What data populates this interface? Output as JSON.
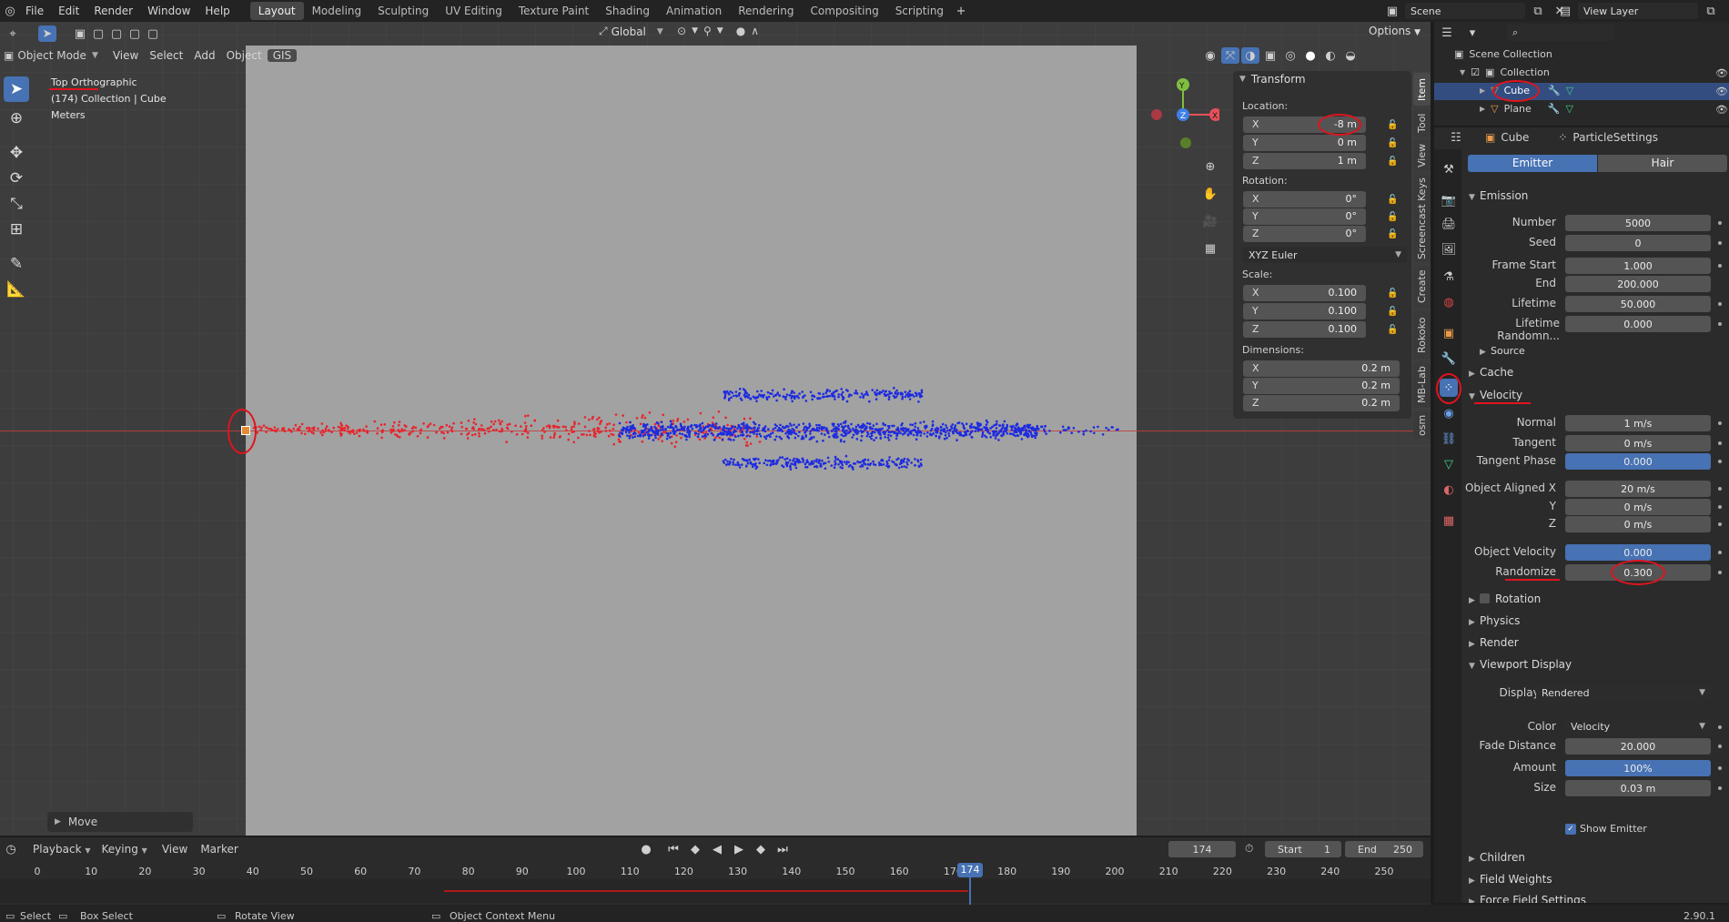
{
  "menu": [
    "File",
    "Edit",
    "Render",
    "Window",
    "Help"
  ],
  "workspaces": [
    "Layout",
    "Modeling",
    "Sculpting",
    "UV Editing",
    "Texture Paint",
    "Shading",
    "Animation",
    "Rendering",
    "Compositing",
    "Scripting"
  ],
  "active_workspace": "Layout",
  "scene_name": "Scene",
  "view_layer": "View Layer",
  "header": {
    "transform_orientation": "Global",
    "options_label": "Options",
    "mode": "Object Mode",
    "menus": [
      "View",
      "Select",
      "Add",
      "Object",
      "GIS"
    ]
  },
  "viewport": {
    "view_name": "Top Orthographic",
    "collection_line": "(174) Collection | Cube",
    "units": "Meters",
    "last_op": "Move"
  },
  "npanel": {
    "title": "Transform",
    "location_label": "Location:",
    "location": [
      {
        "axis": "X",
        "value": "-8 m"
      },
      {
        "axis": "Y",
        "value": "0 m"
      },
      {
        "axis": "Z",
        "value": "1 m"
      }
    ],
    "rotation_label": "Rotation:",
    "rotation": [
      {
        "axis": "X",
        "value": "0°"
      },
      {
        "axis": "Y",
        "value": "0°"
      },
      {
        "axis": "Z",
        "value": "0°"
      }
    ],
    "rotation_mode": "XYZ Euler",
    "scale_label": "Scale:",
    "scale": [
      {
        "axis": "X",
        "value": "0.100"
      },
      {
        "axis": "Y",
        "value": "0.100"
      },
      {
        "axis": "Z",
        "value": "0.100"
      }
    ],
    "dimensions_label": "Dimensions:",
    "dimensions": [
      {
        "axis": "X",
        "value": "0.2 m"
      },
      {
        "axis": "Y",
        "value": "0.2 m"
      },
      {
        "axis": "Z",
        "value": "0.2 m"
      }
    ],
    "tabs": [
      "Item",
      "Tool",
      "View",
      "Screencast Keys",
      "Create",
      "Rokoko",
      "MB-Lab",
      "osm"
    ]
  },
  "outliner": {
    "root": "Scene Collection",
    "collection": "Collection",
    "items": [
      "Cube",
      "Plane"
    ]
  },
  "properties": {
    "object": "Cube",
    "particle_settings": "ParticleSettings",
    "emitter_label": "Emitter",
    "hair_label": "Hair",
    "emission": {
      "title": "Emission",
      "rows": [
        {
          "label": "Number",
          "value": "5000"
        },
        {
          "label": "Seed",
          "value": "0"
        },
        {
          "label": "Frame Start",
          "value": "1.000"
        },
        {
          "label": "End",
          "value": "200.000"
        },
        {
          "label": "Lifetime",
          "value": "50.000"
        },
        {
          "label": "Lifetime Randomn...",
          "value": "0.000"
        }
      ],
      "source": "Source"
    },
    "cache": "Cache",
    "velocity": {
      "title": "Velocity",
      "rows": [
        {
          "label": "Normal",
          "value": "1 m/s",
          "blue": false
        },
        {
          "label": "Tangent",
          "value": "0 m/s",
          "blue": false
        },
        {
          "label": "Tangent Phase",
          "value": "0.000",
          "blue": true
        },
        {
          "label": "Object Aligned X",
          "value": "20 m/s",
          "blue": false
        },
        {
          "label": "Y",
          "value": "0 m/s",
          "blue": false
        },
        {
          "label": "Z",
          "value": "0 m/s",
          "blue": false
        },
        {
          "label": "Object Velocity",
          "value": "0.000",
          "blue": true
        },
        {
          "label": "Randomize",
          "value": "0.300",
          "blue": false
        }
      ]
    },
    "collapsed_sections": [
      "Rotation",
      "Physics",
      "Render"
    ],
    "viewport_display": {
      "title": "Viewport Display",
      "display_as_label": "Display As",
      "display_as": "Rendered",
      "color_label": "Color",
      "color": "Velocity",
      "fade_distance_label": "Fade Distance",
      "fade_distance": "20.000",
      "amount_label": "Amount",
      "amount": "100%",
      "size_label": "Size",
      "size": "0.03 m",
      "show_emitter": "Show Emitter"
    },
    "bottom_sections": [
      "Children",
      "Field Weights",
      "Force Field Settings"
    ]
  },
  "timeline": {
    "menus": [
      "Playback",
      "Keying",
      "View",
      "Marker"
    ],
    "current_frame": "174",
    "start_label": "Start",
    "start": "1",
    "end_label": "End",
    "end": "250",
    "ruler": [
      "0",
      "10",
      "20",
      "30",
      "40",
      "50",
      "60",
      "70",
      "80",
      "90",
      "100",
      "110",
      "120",
      "130",
      "140",
      "150",
      "160",
      "170",
      "180",
      "190",
      "200",
      "210",
      "220",
      "230",
      "240",
      "250"
    ]
  },
  "statusbar": {
    "select": "Select",
    "box_select": "Box Select",
    "rotate_view": "Rotate View",
    "context_menu": "Object Context Menu",
    "version": "2.90.1"
  },
  "colors": {
    "accent": "#4772b3",
    "annotation": "#e0141e",
    "particle_red": "#e8242c",
    "particle_blue": "#1d2be0"
  }
}
